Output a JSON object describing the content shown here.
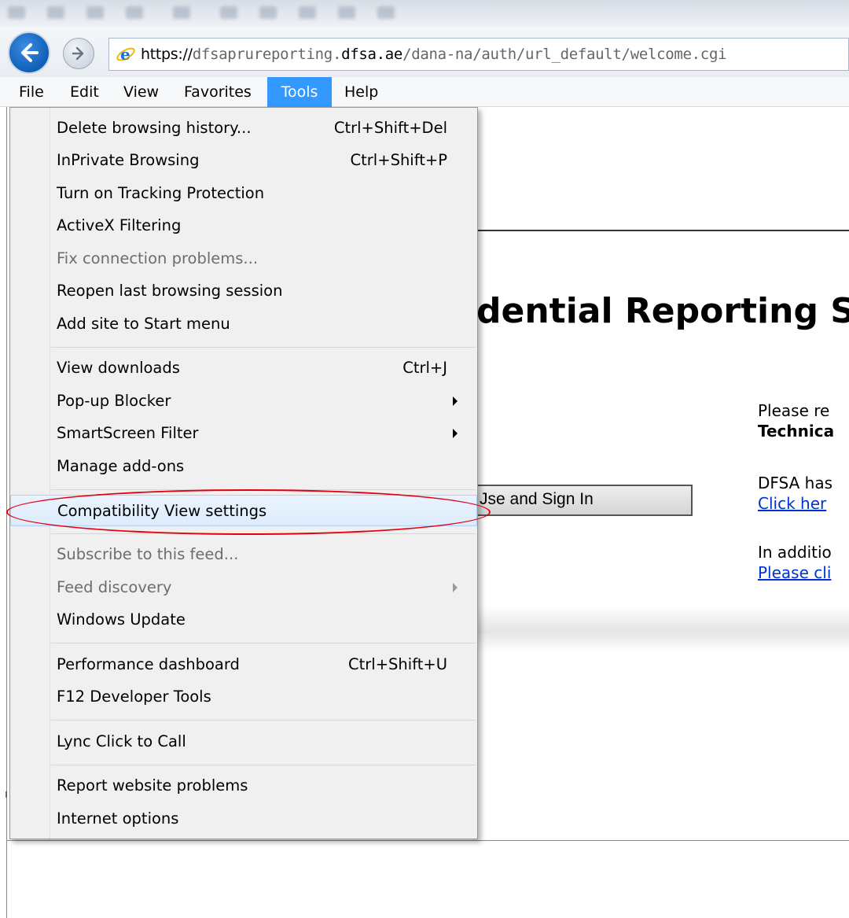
{
  "browser": {
    "url_protocol": "https://",
    "url_prefix": "dfsaprureporting.",
    "url_host": "dfsa.ae",
    "url_path": "/dana-na/auth/url_default/welcome.cgi"
  },
  "menubar": {
    "items": [
      "File",
      "Edit",
      "View",
      "Favorites",
      "Tools",
      "Help"
    ],
    "active": "Tools"
  },
  "tools_menu": {
    "items": [
      {
        "label": "Delete browsing history...",
        "shortcut": "Ctrl+Shift+Del"
      },
      {
        "label": "InPrivate Browsing",
        "shortcut": "Ctrl+Shift+P"
      },
      {
        "label": "Turn on Tracking Protection",
        "shortcut": ""
      },
      {
        "label": "ActiveX Filtering",
        "shortcut": ""
      },
      {
        "label": "Fix connection problems...",
        "shortcut": "",
        "disabled": true
      },
      {
        "label": "Reopen last browsing session",
        "shortcut": ""
      },
      {
        "label": "Add site to Start menu",
        "shortcut": ""
      },
      {
        "label": "View downloads",
        "shortcut": "Ctrl+J"
      },
      {
        "label": "Pop-up Blocker",
        "shortcut": "",
        "submenu": true
      },
      {
        "label": "SmartScreen Filter",
        "shortcut": "",
        "submenu": true
      },
      {
        "label": "Manage add-ons",
        "shortcut": ""
      },
      {
        "label": "Compatibility View settings",
        "shortcut": "",
        "highlighted": true
      },
      {
        "label": "Subscribe to this feed...",
        "shortcut": "",
        "disabled": true
      },
      {
        "label": "Feed discovery",
        "shortcut": "",
        "disabled": true,
        "submenu": true
      },
      {
        "label": "Windows Update",
        "shortcut": ""
      },
      {
        "label": "Performance dashboard",
        "shortcut": "Ctrl+Shift+U"
      },
      {
        "label": "F12 Developer Tools",
        "shortcut": ""
      },
      {
        "label": "Lync Click to Call",
        "shortcut": ""
      },
      {
        "label": "Report website problems",
        "shortcut": ""
      },
      {
        "label": "Internet options",
        "shortcut": ""
      }
    ]
  },
  "page": {
    "heading_fragment": "dential Reporting S",
    "signin_fragment": "Jse and Sign In",
    "side_text_1": "Please re",
    "side_text_2": "Technica",
    "side_text_3": "DFSA has",
    "side_link_1": "Click her",
    "side_text_4": "In additio",
    "side_link_2": "Please cli",
    "stray_char": "ı"
  },
  "colors": {
    "menu_active": "#3399ff",
    "highlight_annotation": "#e3000f",
    "link": "#0033cc"
  }
}
